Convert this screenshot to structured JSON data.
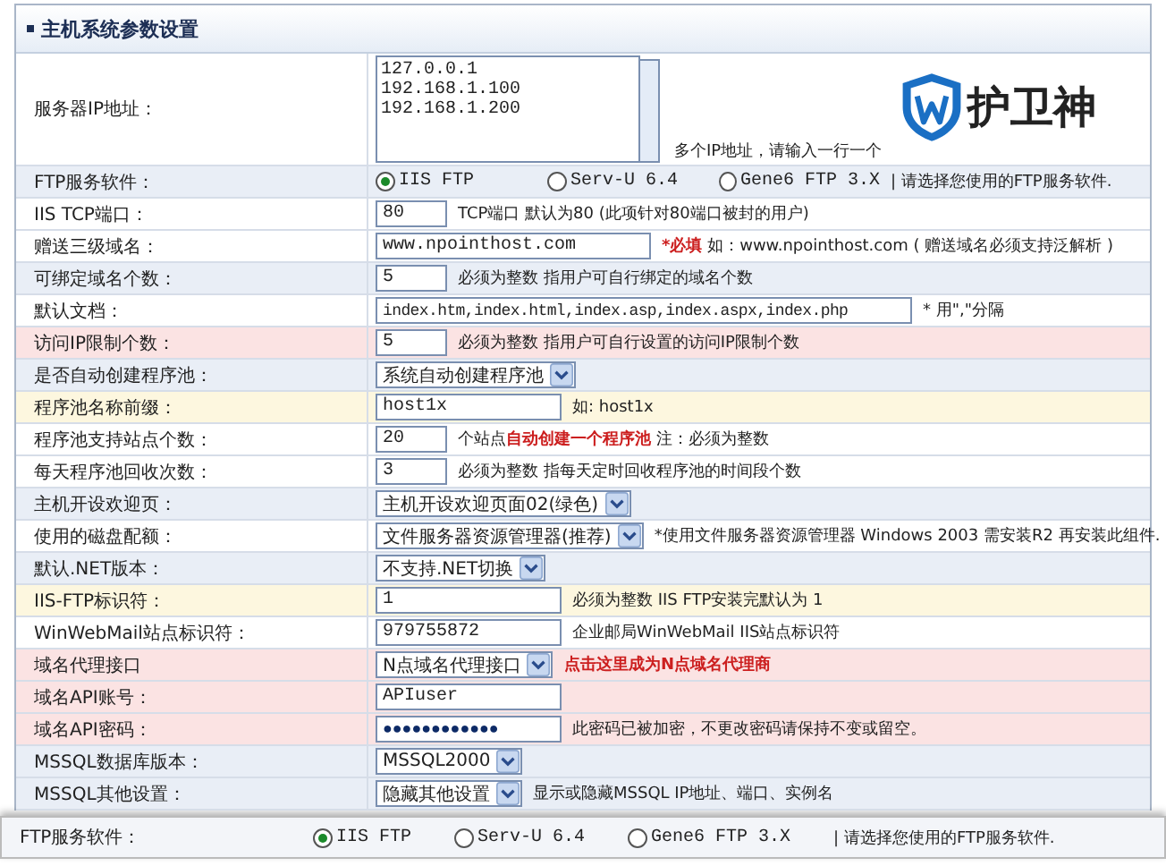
{
  "panel": {
    "title": "主机系统参数设置"
  },
  "logo": {
    "text": "护卫神"
  },
  "rows": [
    {
      "label": "服务器IP地址：",
      "kind": "textarea",
      "color": "#ffffff",
      "lines": [
        "127.0.0.1",
        "192.168.1.100",
        "192.168.1.200"
      ],
      "hint": [
        {
          "text": "多个IP地址，请输入一行一个",
          "emphasis": false
        }
      ]
    },
    {
      "label": "FTP服务软件：",
      "kind": "radio",
      "color": "#e9eef6",
      "options": [
        {
          "label": "IIS FTP",
          "selected": true
        },
        {
          "label": "Serv-U 6.4",
          "selected": false
        },
        {
          "label": "Gene6 FTP 3.X",
          "selected": false
        }
      ],
      "hint": [
        {
          "text": "| 请选择您使用的FTP服务软件.",
          "emphasis": false
        }
      ]
    },
    {
      "label": "IIS TCP端口：",
      "kind": "short-input",
      "color": "#ffffff",
      "value": "80",
      "hint": [
        {
          "text": "TCP端口 默认为80 (此项针对80端口被封的用户)",
          "emphasis": false
        }
      ]
    },
    {
      "label": "赠送三级域名：",
      "kind": "long-input",
      "color": "#ffffff",
      "value": "www.npointhost.com",
      "hint": [
        {
          "text": "*必填",
          "emphasis": true
        },
        {
          "text": " 如：www.npointhost.com ( 赠送域名必须支持泛解析 )",
          "emphasis": false
        }
      ]
    },
    {
      "label": "可绑定域名个数：",
      "kind": "short-input",
      "color": "#e9eef6",
      "value": "5",
      "hint": [
        {
          "text": "必须为整数  指用户可自行绑定的域名个数",
          "emphasis": false
        }
      ]
    },
    {
      "label": "默认文档：",
      "kind": "wide-input",
      "color": "#ffffff",
      "value": "index.htm,index.html,index.asp,index.aspx,index.php",
      "hint": [
        {
          "text": "* 用\",\"分隔",
          "emphasis": false
        }
      ]
    },
    {
      "label": "访问IP限制个数：",
      "kind": "short-input",
      "color": "#fbe3e3",
      "value": "5",
      "hint": [
        {
          "text": "必须为整数  指用户可自行设置的访问IP限制个数",
          "emphasis": false
        }
      ]
    },
    {
      "label": "是否自动创建程序池：",
      "kind": "select",
      "color": "#e9eef6",
      "value": "系统自动创建程序池"
    },
    {
      "label": "程序池名称前缀：",
      "kind": "input",
      "color": "#fdf7df",
      "value": "host1x",
      "hint": [
        {
          "text": "如: host1x",
          "emphasis": false
        }
      ]
    },
    {
      "label": "程序池支持站点个数：",
      "kind": "short-input",
      "color": "#ffffff",
      "value": "20",
      "hint": [
        {
          "text": "个站点",
          "emphasis": false
        },
        {
          "text": "自动创建一个程序池",
          "emphasis": true
        },
        {
          "text": "    注：必须为整数",
          "emphasis": false
        }
      ]
    },
    {
      "label": "每天程序池回收次数：",
      "kind": "short-input",
      "color": "#ffffff",
      "value": "3",
      "hint": [
        {
          "text": "必须为整数  指每天定时回收程序池的时间段个数",
          "emphasis": false
        }
      ]
    },
    {
      "label": "主机开设欢迎页：",
      "kind": "select",
      "color": "#e9eef6",
      "value": "主机开设欢迎页面02(绿色)"
    },
    {
      "label": "使用的磁盘配额：",
      "kind": "select",
      "color": "#ffffff",
      "value": "文件服务器资源管理器(推荐)",
      "hint": [
        {
          "text": "*使用文件服务器资源管理器 Windows 2003 需安装R2 再安装此组件.",
          "emphasis": false
        }
      ]
    },
    {
      "label": "默认.NET版本：",
      "kind": "select",
      "color": "#e9eef6",
      "value": "不支持.NET切换"
    },
    {
      "label": "IIS-FTP标识符：",
      "kind": "input",
      "color": "#fdf7df",
      "value": "1",
      "hint": [
        {
          "text": "必须为整数 IIS FTP安装完默认为 1",
          "emphasis": false
        }
      ]
    },
    {
      "label": "WinWebMail站点标识符：",
      "kind": "input",
      "color": "#ffffff",
      "value": "979755872",
      "hint": [
        {
          "text": "企业邮局WinWebMail IIS站点标识符",
          "emphasis": false
        }
      ]
    },
    {
      "label": "域名代理接口",
      "kind": "select",
      "color": "#fbe3e3",
      "value": "N点域名代理接口",
      "hint": [
        {
          "text": "点击这里成为N点域名代理商",
          "emphasis": true
        }
      ]
    },
    {
      "label": "域名API账号：",
      "kind": "input",
      "color": "#fbe3e3",
      "value": "APIuser"
    },
    {
      "label": "域名API密码：",
      "kind": "password",
      "color": "#fbe3e3",
      "value": "●●●●●●●●●●●●",
      "hint": [
        {
          "text": "此密码已被加密，不更改密码请保持不变或留空。",
          "emphasis": false
        }
      ]
    },
    {
      "label": "MSSQL数据库版本：",
      "kind": "select",
      "color": "#e9eef6",
      "value": "MSSQL2000"
    },
    {
      "label": "MSSQL其他设置：",
      "kind": "select",
      "color": "#e9eef6",
      "value": "隐藏其他设置",
      "hint": [
        {
          "text": "显示或隐藏MSSQL IP地址、端口、实例名",
          "emphasis": false
        }
      ]
    }
  ],
  "floating_row": {
    "label": "FTP服务软件：",
    "options": [
      {
        "label": "IIS FTP",
        "selected": true
      },
      {
        "label": "Serv-U 6.4",
        "selected": false
      },
      {
        "label": "Gene6 FTP 3.X",
        "selected": false
      }
    ],
    "hint": "| 请选择您使用的FTP服务软件."
  }
}
